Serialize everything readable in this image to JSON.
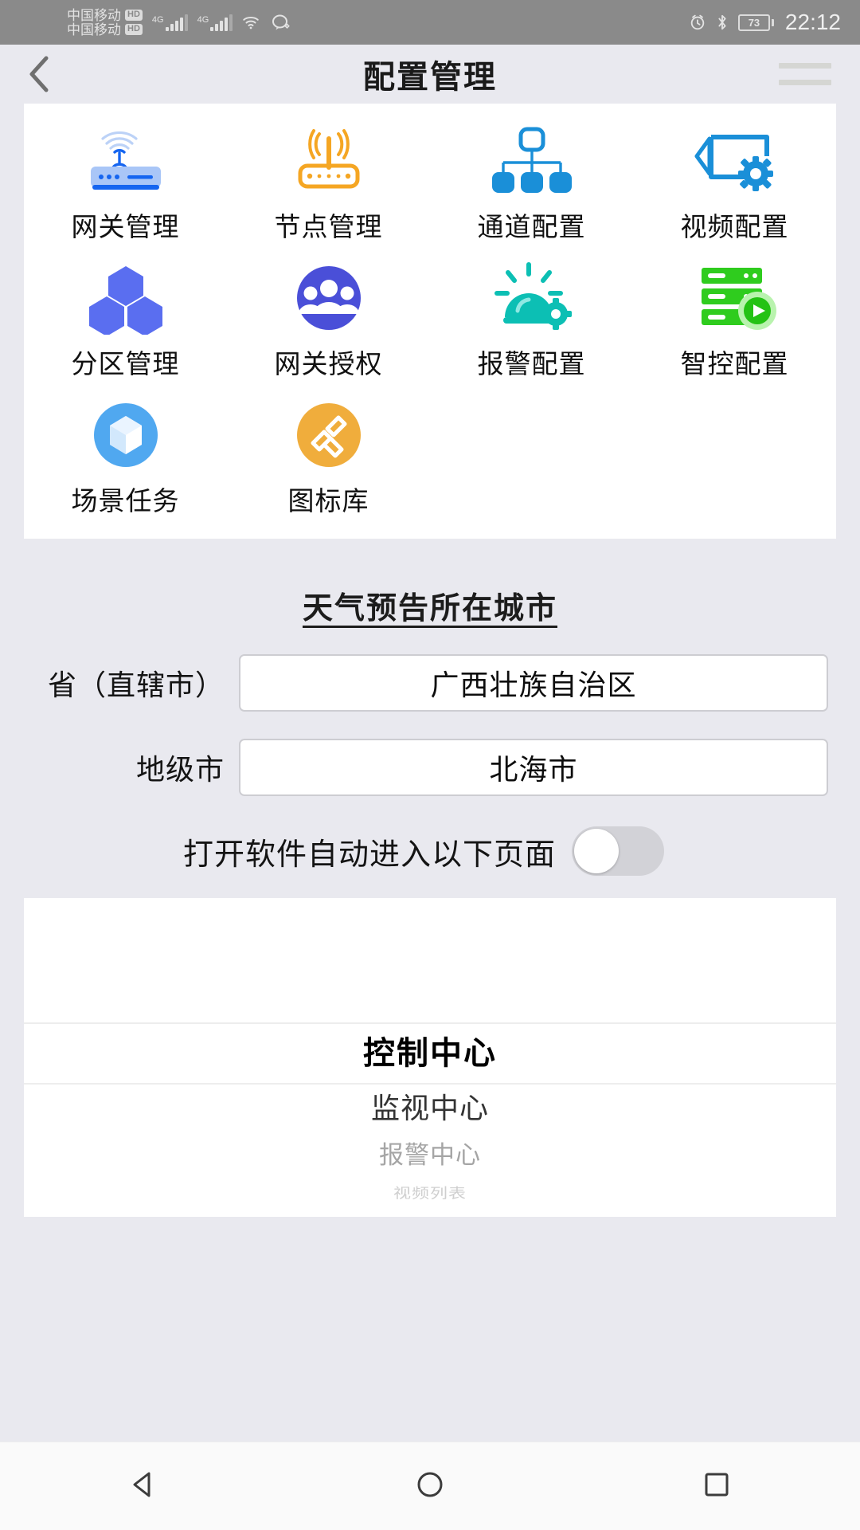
{
  "status_bar": {
    "carrier_1": "中国移动",
    "carrier_2": "中国移动",
    "hd_badge_1": "HD",
    "hd_badge_2": "HD",
    "network_1": "4G",
    "network_2": "4G",
    "battery_percent": "73",
    "time": "22:12",
    "icons": [
      "wifi-icon",
      "message-bubble-icon",
      "alarm-clock-icon",
      "bluetooth-icon",
      "battery-icon"
    ],
    "background_color": "#8a8a8a"
  },
  "header": {
    "title": "配置管理",
    "back_icon": "chevron-left-icon",
    "menu_icon": "hamburger-menu-icon"
  },
  "grid": {
    "items": [
      {
        "label": "网关管理",
        "icon": "router-gateway-icon",
        "color": "#1565f0"
      },
      {
        "label": "节点管理",
        "icon": "wireless-node-router-icon",
        "color": "#f5a623"
      },
      {
        "label": "通道配置",
        "icon": "hierarchy-tree-icon",
        "color": "#1a8fd8"
      },
      {
        "label": "视频配置",
        "icon": "video-camera-gear-icon",
        "color": "#1a8fd8"
      },
      {
        "label": "分区管理",
        "icon": "hexagon-cluster-icon",
        "color": "#5a6ef0"
      },
      {
        "label": "网关授权",
        "icon": "users-group-circle-icon",
        "color": "#4a4fd8"
      },
      {
        "label": "报警配置",
        "icon": "alarm-bell-gear-icon",
        "color": "#0cbfb4"
      },
      {
        "label": "智控配置",
        "icon": "server-play-icon",
        "color": "#2fcc1e"
      },
      {
        "label": "场景任务",
        "icon": "cube-circle-icon",
        "color": "#50a8f0"
      },
      {
        "label": "图标库",
        "icon": "icon-library-circle-icon",
        "color": "#f0ad3c"
      }
    ]
  },
  "weather": {
    "section_title": "天气预告所在城市",
    "province_label": "省（直辖市）",
    "province_value": "广西壮族自治区",
    "city_label": "地级市",
    "city_value": "北海市"
  },
  "autostart": {
    "label": "打开软件自动进入以下页面",
    "toggle_on": false
  },
  "picker": {
    "options": [
      "控制中心",
      "监视中心",
      "报警中心",
      "视频列表"
    ],
    "selected": "控制中心"
  },
  "navbar": {
    "back_icon": "nav-back-triangle-icon",
    "home_icon": "nav-home-circle-icon",
    "recents_icon": "nav-recents-square-icon"
  }
}
